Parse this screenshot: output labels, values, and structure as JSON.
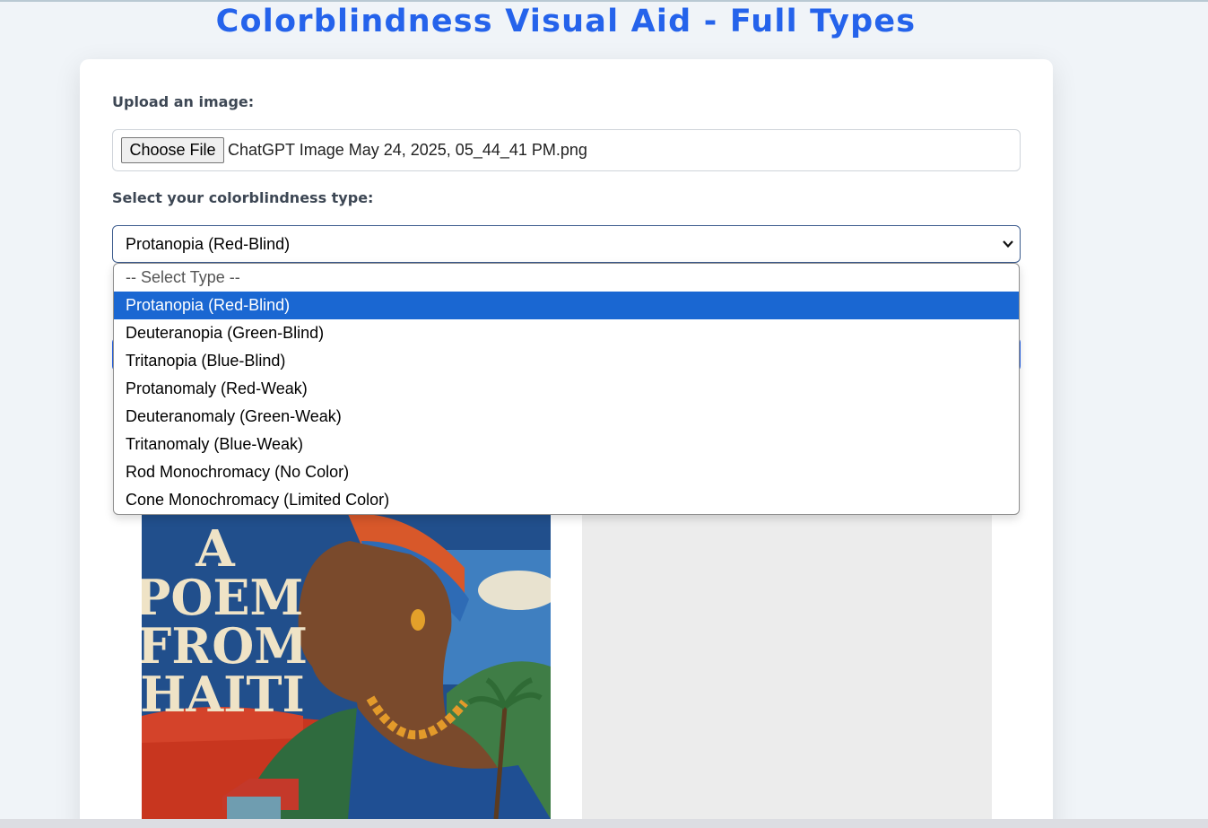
{
  "page": {
    "title": "Colorblindness Visual Aid - Full Types"
  },
  "upload": {
    "label": "Upload an image:",
    "button_label": "Choose File",
    "file_name": "ChatGPT Image May 24, 2025, 05_44_41 PM.png"
  },
  "type_select": {
    "label": "Select your colorblindness type:",
    "value": "Protanopia (Red-Blind)",
    "options": [
      "-- Select Type --",
      "Protanopia (Red-Blind)",
      "Deuteranopia (Green-Blind)",
      "Tritanopia (Blue-Blind)",
      "Protanomaly (Red-Weak)",
      "Deuteranomaly (Green-Weak)",
      "Tritanomaly (Blue-Weak)",
      "Rod Monochromacy (No Color)",
      "Cone Monochromacy (Limited Color)"
    ],
    "selected_index": 1
  },
  "preview": {
    "image_lines": [
      "A",
      "POEM",
      "FROM",
      "HAITI"
    ]
  },
  "colors": {
    "accent": "#2563eb",
    "selected_option": "#1a67d2",
    "background": "#f0f4f8",
    "card": "#ffffff",
    "simulated_placeholder": "#ececec"
  }
}
